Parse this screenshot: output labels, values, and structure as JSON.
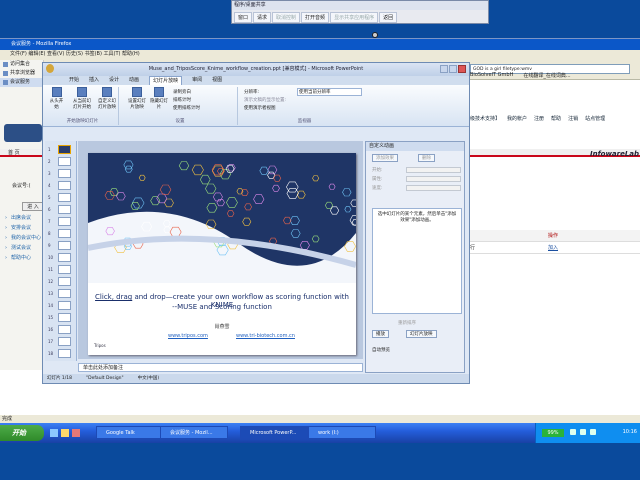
{
  "remote_control": {
    "title": "程序/桌面共享",
    "buttons": [
      "窗口",
      "请求",
      "取消控制",
      "打开音频",
      "显示共享应用程序",
      "返回"
    ],
    "disabled": [
      false,
      false,
      true,
      false,
      true,
      false
    ]
  },
  "firefox": {
    "title": "会议服务 - Mozilla Firefox",
    "menu": "文件(F)  编辑(E)  查看(V)  历史(S)  书签(B)  工具(T)  帮助(H)",
    "url": "GOD is a girl filetype:wmv",
    "bookmarks": [
      "BioSolveIT GmbH",
      "在线翻译_在线词典..."
    ],
    "status": "完成",
    "sidebar": [
      "访问集合",
      "共享浏览器",
      "会议服务"
    ]
  },
  "website": {
    "top_nav": [
      "【高级技术支持】",
      "我的帐户",
      "注册",
      "帮助",
      "注销",
      "站点管理"
    ],
    "header_left": "首 页",
    "logo": "InfowareLab",
    "meeting_label": "会议号:(",
    "enter": "进 入",
    "menu": [
      "出席会议",
      "安排会议",
      "我的会议中心",
      "测试会议",
      "帮助中心"
    ],
    "table_head": [
      "",
      "操作"
    ],
    "table_rows": [
      [
        "行",
        "加入"
      ]
    ]
  },
  "powerpoint": {
    "title": "Muse_and_TriposScore_Knime_workflow_creation.ppt [兼容模式] - Microsoft PowerPoint",
    "tabs": [
      "开始",
      "插入",
      "设计",
      "动画",
      "幻灯片放映",
      "审阅",
      "视图"
    ],
    "active_tab": "幻灯片放映",
    "ribbon": {
      "groups": [
        "开始放映幻灯片",
        "设置",
        "监视器"
      ],
      "buttons": [
        "从头开始",
        "从当前幻灯片开始",
        "自定义幻灯片放映",
        "设置幻灯片放映",
        "隐藏幻灯片"
      ],
      "checks": [
        "录制旁白",
        "排练计时",
        "使用排练计时"
      ],
      "monitor": [
        "分辨率:",
        "使用当前分辨率",
        "演示文稿的显示位置:",
        "使用演示者视图"
      ]
    },
    "slide_count": 18,
    "slide": {
      "line1_prefix": "Click, drag",
      "line1_rest": " and drop—create your own workflow as scoring function with KNIME",
      "line2": "--MUSE and Scoring function",
      "author": "肖燕雪",
      "link1": "www.tripos.com",
      "link2": "www.tri-biotech.com.cn",
      "corner": "Tripos"
    },
    "notes": "单击此处添加备注",
    "status": [
      "幻灯片 1/18",
      "\"Default Design\"",
      "中文(中国)"
    ],
    "pane": {
      "title": "自定义动画",
      "add_button": "添加效果",
      "remove": "删除",
      "fields": [
        "开始:",
        "属性:",
        "速度:"
      ],
      "hint": "选中幻灯片的某个元素，然后单击\"添加效果\"添加动画。",
      "reorder": "重新排序",
      "play": "播放",
      "slideshow": "幻灯片放映",
      "autopreview": "自动预览"
    }
  },
  "taskbar": {
    "start": "开始",
    "tasks": [
      "Google Talk",
      "会议服务 - Mozil...",
      "Microsoft PowerP...",
      "work (I:)"
    ],
    "active_index": 2,
    "battery": "99%",
    "clock": "10:16"
  },
  "colors": {
    "desktop": "#0a4a9c",
    "accent": "#245edb",
    "web_red": "#c9071a"
  }
}
